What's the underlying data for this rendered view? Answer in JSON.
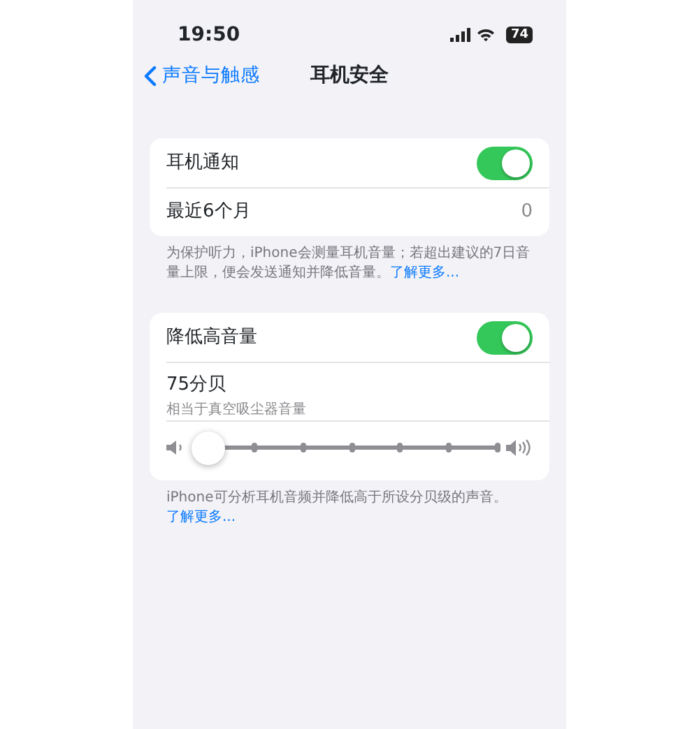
{
  "status_bar": {
    "time": "19:50",
    "battery": "74"
  },
  "nav": {
    "back": "声音与触感",
    "title": "耳机安全"
  },
  "sections": [
    {
      "rows": [
        {
          "kind": "toggle",
          "label": "耳机通知",
          "on": true
        },
        {
          "kind": "value",
          "label": "最近6个月",
          "value": "0"
        }
      ],
      "footer": "为保护听力，iPhone会测量耳机音量；若超出建议的7日音量上限，便会发送通知并降低音量。",
      "footer_link": "了解更多..."
    },
    {
      "rows": [
        {
          "kind": "toggle",
          "label": "降低高音量",
          "on": true
        },
        {
          "kind": "subtitle",
          "label": "75分贝",
          "subtitle": "相当于真空吸尘器音量"
        },
        {
          "kind": "slider",
          "level": 0
        }
      ],
      "footer": "iPhone可分析耳机音频并降低高于所设分贝级的声音。",
      "footer_link": "了解更多..."
    }
  ]
}
